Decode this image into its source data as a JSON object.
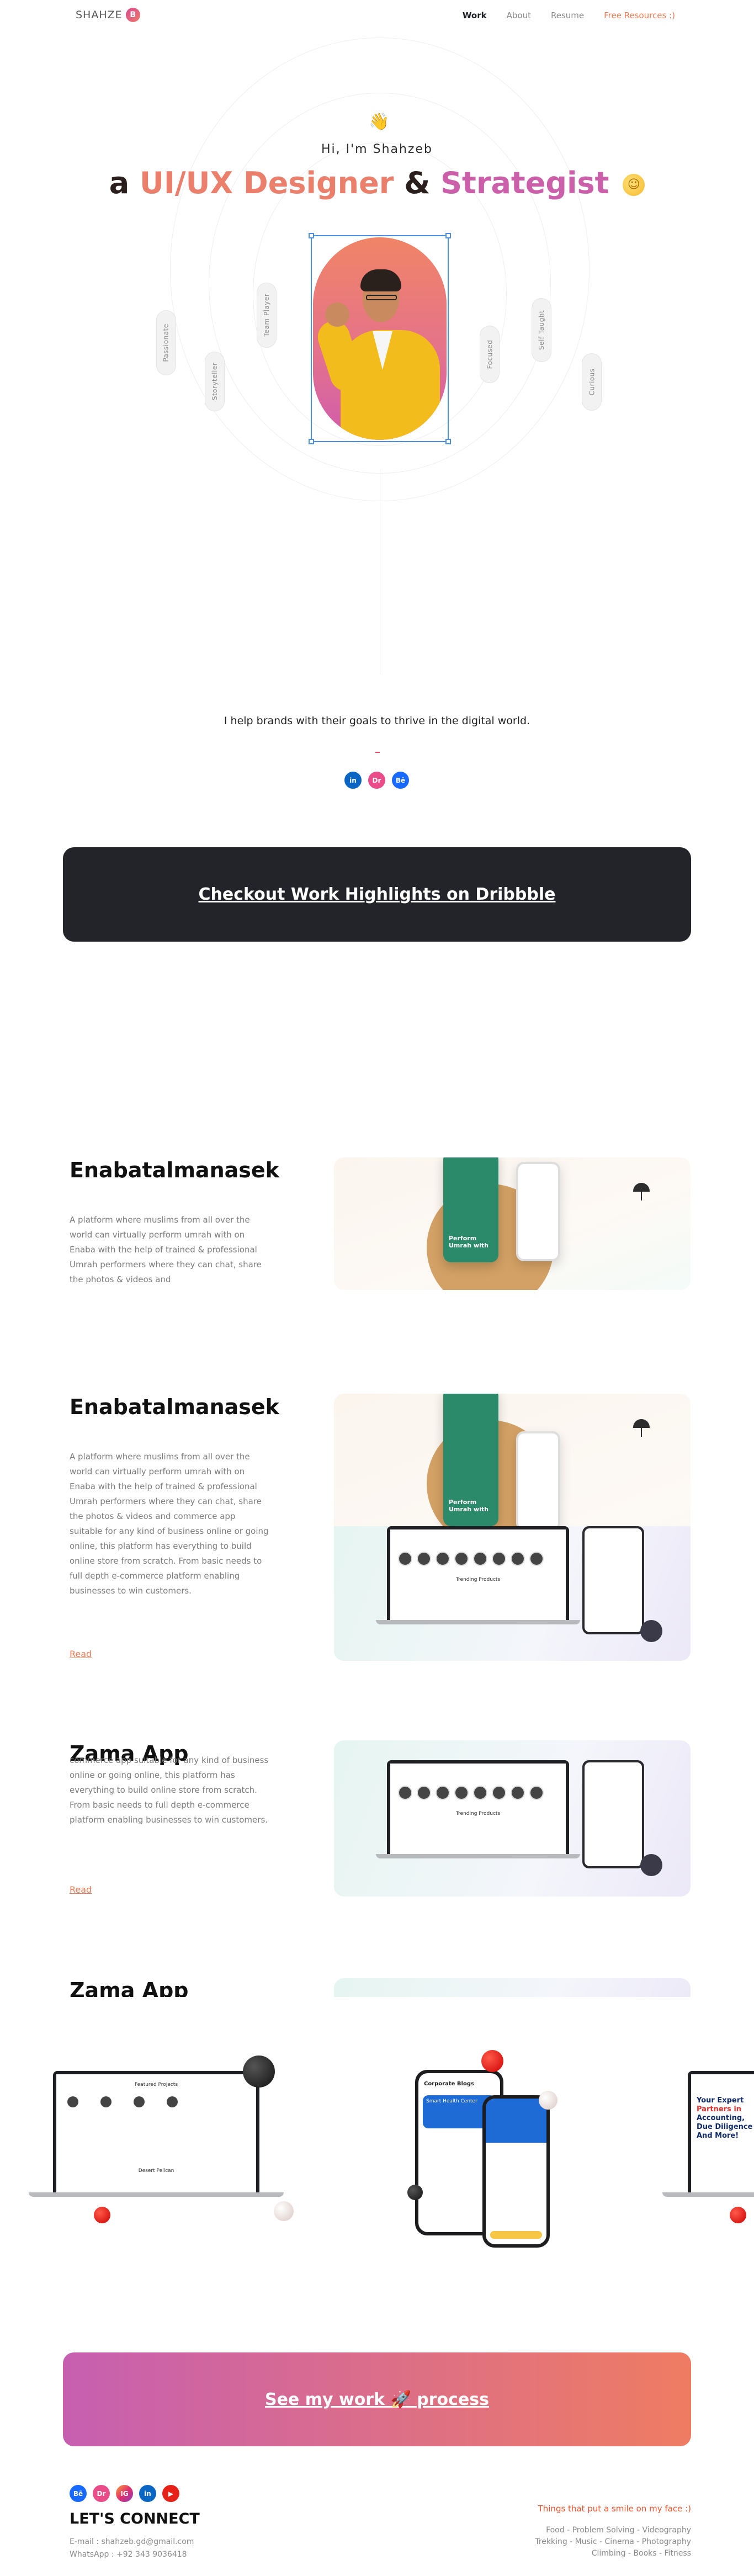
{
  "nav": {
    "logo_text": "SHAHZE",
    "logo_badge": "B",
    "links": [
      "Work",
      "About",
      "Resume",
      "Free Resources :)"
    ]
  },
  "hero": {
    "greeting": "Hi, I'm Shahzeb",
    "headline_prefix": "a",
    "headline_part1": "UI/UX Designer",
    "headline_amp": "&",
    "headline_part2": "Strategist",
    "traits": [
      "Passionate",
      "Storyteller",
      "Team Player",
      "Focused",
      "Self Taught",
      "Curious"
    ],
    "tagline": "I help brands with their goals to thrive in the digital world.",
    "socials": [
      "in",
      "Dr",
      "Bē"
    ]
  },
  "dribbble_banner": "Checkout Work Highlights on Dribbble",
  "projects": [
    {
      "title": "Enabatalmanasek",
      "description": "A platform where muslims from all over the world can virtually perform umrah with on Enaba with the help of trained & professional Umrah performers where they can chat, share the photos & videos and",
      "phone_text": "Perform Umrah with"
    },
    {
      "title": "Enabatalmanasek",
      "description": "A platform where muslims from all over the world can virtually perform umrah with on Enaba with the help of trained & professional Umrah performers where they can chat, share the photos & videos and commerce app suitable for any kind of business online or going online, this platform has everything to build online store from scratch. From basic needs to full depth e-commerce platform enabling businesses to win customers.",
      "read_label": "Read",
      "phone_text": "Perform Umrah with",
      "laptop_caption": "Trending Products"
    },
    {
      "title": "Zama App",
      "description": "commerce app suitable for any kind of business online or going online, this platform has everything to build online store from scratch. From basic needs to full depth e-commerce platform enabling businesses to win customers.",
      "read_label": "Read",
      "laptop_caption": "Trending Products"
    },
    {
      "title": "Zama App"
    }
  ],
  "showcase": {
    "laptop1_caption": "Featured Projects",
    "laptop1_sub": "Desert Pelican",
    "phone_title": "Corporate Blogs",
    "phone_card": "Smart Health Center",
    "right_text_1": "Your Expert",
    "right_text_2": "Partners in",
    "right_text_3": "Accounting,",
    "right_text_4": "Due Diligence",
    "right_text_5": "And More!"
  },
  "process_banner": "See my work 🚀 process",
  "footer": {
    "socials": [
      "Bē",
      "Dr",
      "IG",
      "in",
      "▶"
    ],
    "connect_title": "LET'S CONNECT",
    "email": "E-mail : shahzeb.gd@gmail.com",
    "whatsapp": "WhatsApp : +92 343 9036418",
    "smile_title": "Things that put a smile on my face :)",
    "hobbies_1": "Food - Problem Solving - Videography",
    "hobbies_2": "Trekking - Music - Cinema - Photography",
    "hobbies_3": "Climbing - Books - Fitness"
  },
  "colors": {
    "accent_orange": "#f07a53",
    "accent_pink": "#cb5fa9",
    "dark_banner": "#222429"
  }
}
